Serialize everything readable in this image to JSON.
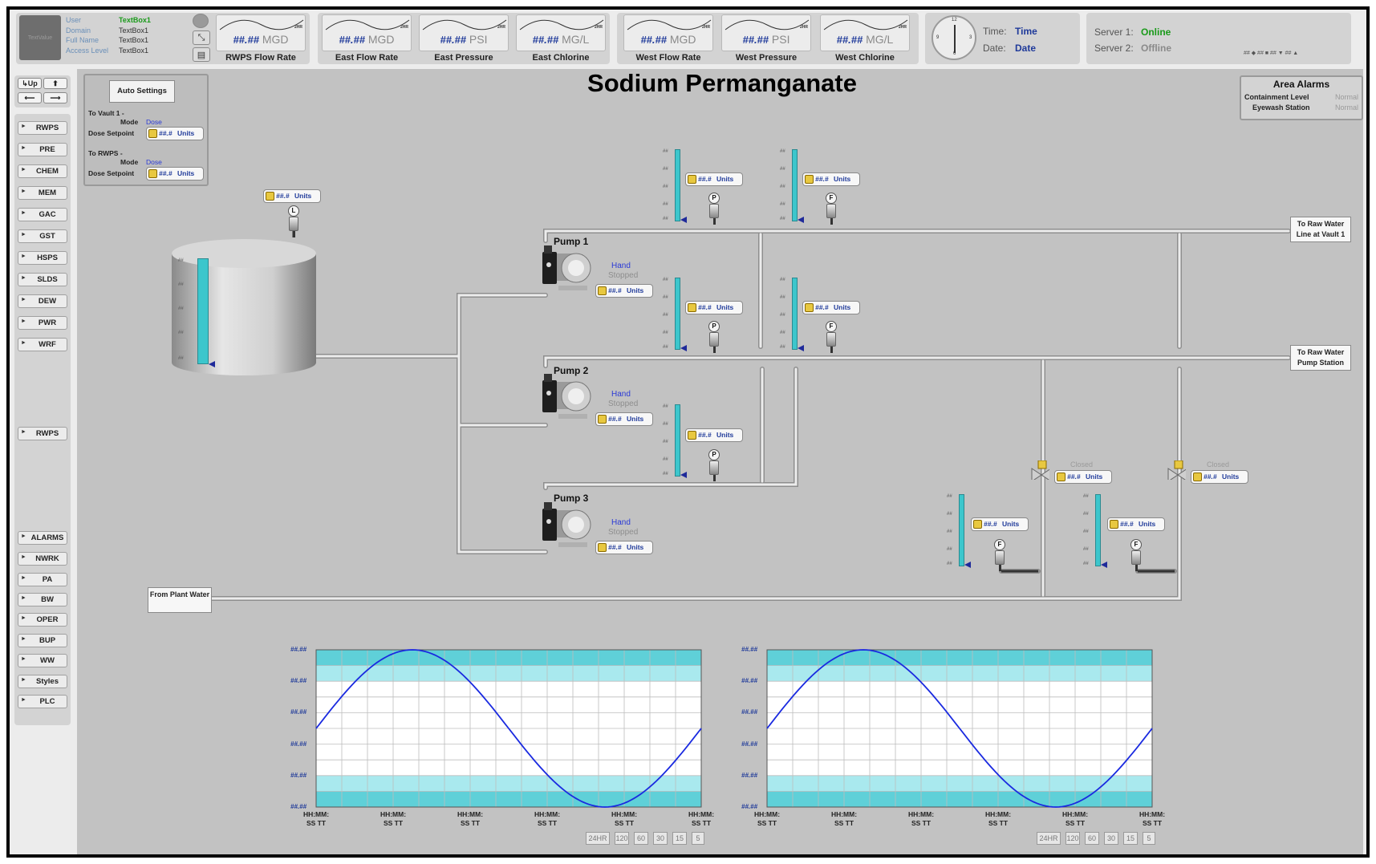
{
  "user": {
    "avatar_text": "TextValue",
    "labels": [
      "User",
      "Domain",
      "Full Name",
      "Access Level"
    ],
    "values": [
      "TextBox1",
      "TextBox1",
      "TextBox1",
      "TextBox1"
    ]
  },
  "mini_trends": [
    {
      "value": "##.##",
      "unit": "MGD",
      "label": "RWPS Flow Rate",
      "tag": "2HR"
    },
    {
      "value": "##.##",
      "unit": "MGD",
      "label": "East Flow Rate",
      "tag": "2HR"
    },
    {
      "value": "##.##",
      "unit": "PSI",
      "label": "East Pressure",
      "tag": "2HR"
    },
    {
      "value": "##.##",
      "unit": "MG/L",
      "label": "East Chlorine",
      "tag": "2HR"
    },
    {
      "value": "##.##",
      "unit": "MGD",
      "label": "West Flow Rate",
      "tag": "2HR"
    },
    {
      "value": "##.##",
      "unit": "PSI",
      "label": "West Pressure",
      "tag": "2HR"
    },
    {
      "value": "##.##",
      "unit": "MG/L",
      "label": "West Chlorine",
      "tag": "2HR"
    }
  ],
  "clock": {
    "time_label": "Time:",
    "time_value": "Time",
    "date_label": "Date:",
    "date_value": "Date"
  },
  "servers": [
    {
      "label": "Server 1:",
      "status": "Online",
      "color": "#1a9a1a"
    },
    {
      "label": "Server 2:",
      "status": "Offline",
      "color": "#8a8a8a"
    }
  ],
  "legend_strip": "## ◆ ## ■ ## ▼ ## ▲",
  "nav_top": {
    "up": "Up"
  },
  "nav_main": [
    "RWPS",
    "PRE",
    "CHEM",
    "MEM",
    "GAC",
    "GST",
    "HSPS",
    "SLDS",
    "DEW",
    "PWR",
    "WRF"
  ],
  "nav_extra": [
    "RWPS"
  ],
  "nav_bottom": [
    "ALARMS",
    "NWRK",
    "PA",
    "BW",
    "OPER",
    "BUP",
    "WW",
    "Styles",
    "PLC"
  ],
  "title": "Sodium Permanganate",
  "auto_settings": {
    "button": "Auto Settings",
    "vault_header": "To Vault 1 -",
    "rwps_header": "To RWPS -",
    "mode_label": "Mode",
    "mode_value": "Dose",
    "setpoint_label": "Dose Setpoint"
  },
  "field": {
    "value": "##.#",
    "unit": "Units"
  },
  "area_alarms": {
    "title": "Area Alarms",
    "rows": [
      {
        "label": "Containment Level",
        "value": "Normal"
      },
      {
        "label": "Eyewash Station",
        "value": "Normal"
      }
    ]
  },
  "destinations": {
    "vault": "To Raw Water Line at Vault 1",
    "station": "To Raw Water Pump Station",
    "source": "From Plant Water"
  },
  "pumps": [
    {
      "name": "Pump 1",
      "mode": "Hand",
      "state": "Stopped"
    },
    {
      "name": "Pump 2",
      "mode": "Hand",
      "state": "Stopped"
    },
    {
      "name": "Pump 3",
      "mode": "Hand",
      "state": "Stopped"
    }
  ],
  "instruments": {
    "level": "L",
    "pressure": "P",
    "flow": "F"
  },
  "bar_tick": "##",
  "valve_state": "Closed",
  "trend": {
    "y_label": "##.##",
    "x_label_line1": "HH:MM:",
    "x_label_line2": "SS TT",
    "buttons": [
      "24HR",
      "120",
      "60",
      "30",
      "15",
      "5"
    ]
  },
  "chart_data": [
    {
      "type": "line",
      "series": [
        {
          "values": [
            0.5,
            0.84,
            1.0,
            0.84,
            0.5,
            0.16,
            0.0,
            0.16,
            0.5
          ]
        }
      ],
      "x": [
        0,
        1,
        2,
        3,
        4,
        5,
        6,
        7,
        8
      ],
      "ylim": [
        0,
        1
      ],
      "grid": true,
      "band_colors": [
        "#5fd0d8",
        "#a9e9ee",
        "#ffffff"
      ]
    },
    {
      "type": "line",
      "series": [
        {
          "values": [
            0.5,
            0.84,
            1.0,
            0.84,
            0.5,
            0.16,
            0.0,
            0.16,
            0.5
          ]
        }
      ],
      "x": [
        0,
        1,
        2,
        3,
        4,
        5,
        6,
        7,
        8
      ],
      "ylim": [
        0,
        1
      ],
      "grid": true,
      "band_colors": [
        "#5fd0d8",
        "#a9e9ee",
        "#ffffff"
      ]
    }
  ],
  "colors": {
    "accent_blue": "#1f3a9a",
    "cyan": "#3cc6cc",
    "pipe": "#e8e8e8"
  }
}
